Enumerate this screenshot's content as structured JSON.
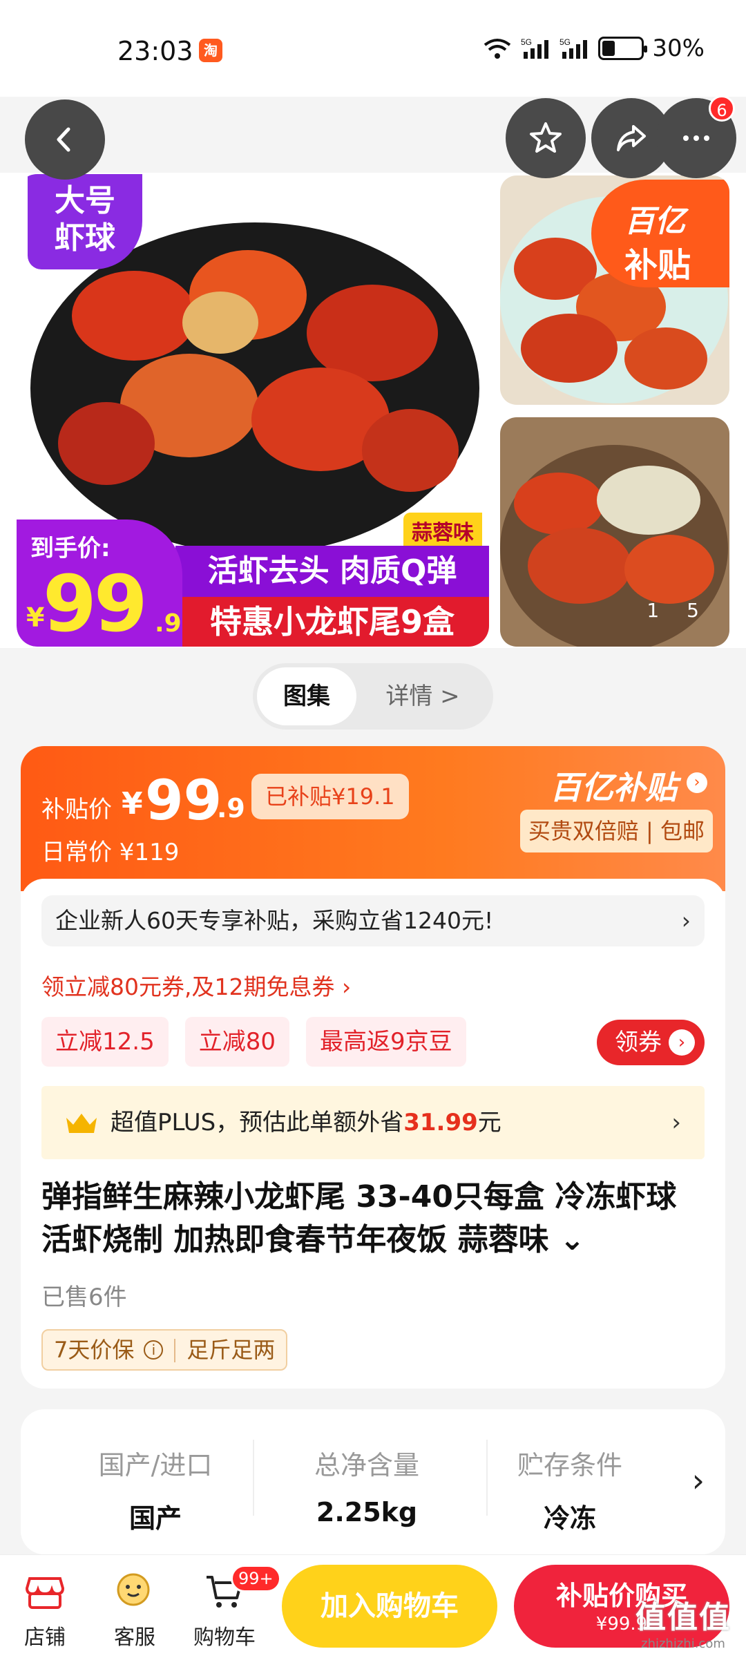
{
  "status_bar": {
    "time": "23:03",
    "app_icon": "淘",
    "network_1": "5G",
    "network_2": "5G",
    "battery_level": 0.3,
    "battery_text": "30%"
  },
  "nav": {
    "more_badge": "6"
  },
  "gallery": {
    "tag_big": "大号\n虾球",
    "flavor": "蒜蓉味",
    "banner_1": "活虾去头 肉质Q弹",
    "banner_2": "特惠小龙虾尾9盒",
    "price_label": "到手价:",
    "price_currency": "¥",
    "price_int": "99",
    "price_dec": ".9",
    "subsidy_badge_1": "百亿",
    "subsidy_badge_2": "补贴",
    "counter_current": "1",
    "counter_total": "5"
  },
  "tabs": {
    "gallery": "图集",
    "details": "详情 >"
  },
  "price_card": {
    "label": "补贴价",
    "currency": "¥",
    "int": "99",
    "dec": ".9",
    "subsidized": "已补贴¥19.1",
    "daily": "日常价 ¥119",
    "brand": "百亿补贴",
    "promise": "买贵双倍赔 | 包邮"
  },
  "promo": {
    "newuser": "企业新人60天专享补贴，采购立省1240元!",
    "coupon_link": "领立减80元券,及12期免息券 ›",
    "chips": [
      "立减12.5",
      "立减80",
      "最高返9京豆"
    ],
    "grab_button": "领券",
    "plus_prefix": "超值PLUS，预估此单额外省",
    "plus_amount": "31.99",
    "plus_suffix": "元"
  },
  "product": {
    "title": "弹指鲜生麻辣小龙虾尾 33-40只每盒 冷冻虾球活虾烧制 加热即食春节年夜饭 蒜蓉味 ⌄",
    "sold": "已售6件",
    "guarantee_1": "7天价保",
    "guarantee_2": "足斤足两"
  },
  "specs": [
    {
      "key": "国产/进口",
      "value": "国产"
    },
    {
      "key": "总净含量",
      "value": "2.25kg"
    },
    {
      "key": "贮存条件",
      "value": "冷冻"
    }
  ],
  "bottom": {
    "store": "店铺",
    "service": "客服",
    "cart": "购物车",
    "cart_badge": "99+",
    "add_cart": "加入购物车",
    "buy_1": "补贴价购买",
    "buy_2": "¥99.9",
    "watermark_1": "值值值",
    "watermark_2": "zhizhizhi.com"
  },
  "colors": {
    "accent": "#ff5a14",
    "red": "#e8262a",
    "yellow": "#ffd21a",
    "purple": "#8a0fd6"
  }
}
